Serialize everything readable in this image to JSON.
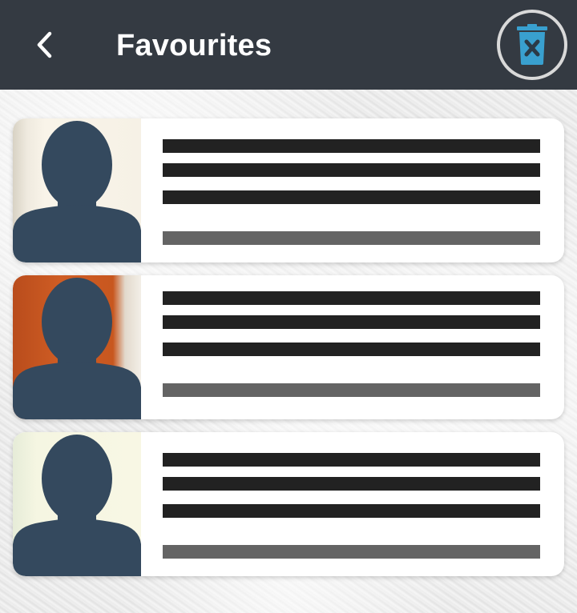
{
  "app_bar": {
    "title": "Favourites",
    "background": "#343a42",
    "back_icon": "chevron-left-icon",
    "delete_icon": "trash-x-icon",
    "delete_icon_color": "#39a0cf"
  },
  "favourites": {
    "items": [
      {
        "thumbnail_bg": "#f6f1e6",
        "avatar_color": "#34495e"
      },
      {
        "thumbnail_bg": "#c8571f",
        "avatar_color": "#34495e"
      },
      {
        "thumbnail_bg": "#f8f7e4",
        "avatar_color": "#34495e"
      }
    ]
  }
}
